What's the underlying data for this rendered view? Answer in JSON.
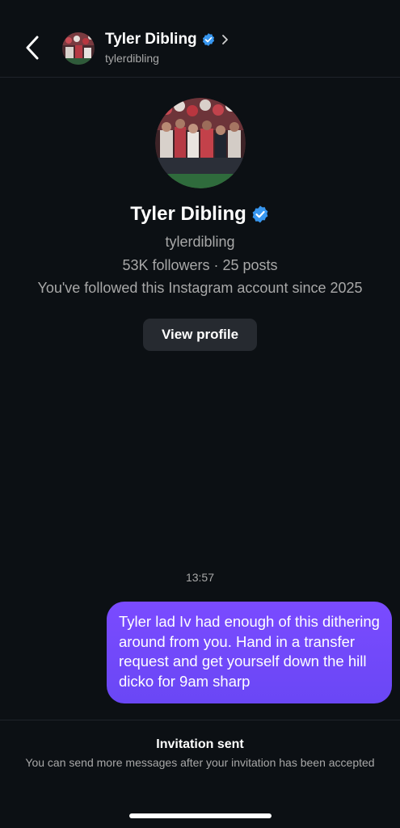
{
  "header": {
    "name": "Tyler Dibling",
    "username": "tylerdibling",
    "back_icon": "chevron-left-icon",
    "chevron_icon": "chevron-right-icon",
    "verified_icon": "verified-badge-icon"
  },
  "profile": {
    "name": "Tyler Dibling",
    "username": "tylerdibling",
    "stats": "53K followers · 25 posts",
    "followed_since": "You've followed this Instagram account since 2025",
    "view_profile_label": "View profile"
  },
  "messages": {
    "timestamp": "13:57",
    "items": [
      {
        "text": "Tyler lad Iv had enough of this dithering around from you. Hand in a transfer request and get yourself down the hill dicko for 9am sharp"
      }
    ]
  },
  "footer": {
    "title": "Invitation sent",
    "subtitle": "You can send more messages after your invitation has been accepted"
  },
  "colors": {
    "background": "#0c1014",
    "bubble": "#7a4bff",
    "verified": "#3897f0",
    "secondary_text": "#a8a8a8",
    "button_bg": "#262a30"
  }
}
